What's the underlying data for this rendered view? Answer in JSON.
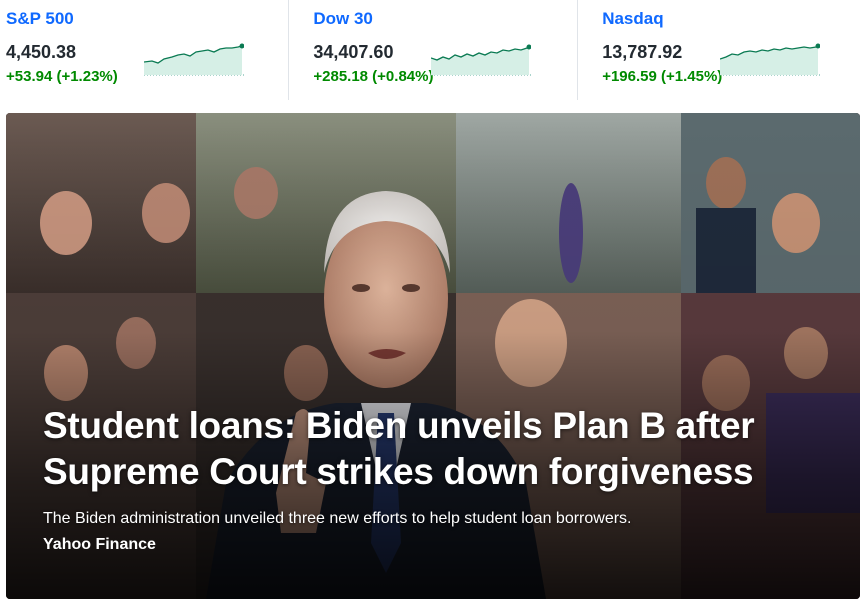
{
  "tickers": [
    {
      "name": "S&P 500",
      "price": "4,450.38",
      "change": "+53.94 (+1.23%)"
    },
    {
      "name": "Dow 30",
      "price": "34,407.60",
      "change": "+285.18 (+0.84%)"
    },
    {
      "name": "Nasdaq",
      "price": "13,787.92",
      "change": "+196.59 (+1.45%)"
    }
  ],
  "colors": {
    "link": "#0f69ff",
    "positive": "#008a00",
    "spark_fill": "#d6efe6",
    "spark_line": "#0a7a52"
  },
  "hero": {
    "title": "Student loans: Biden unveils Plan B after Supreme Court strikes down forgiveness",
    "description": "The Biden administration unveiled three new efforts to help student loan borrowers.",
    "source": "Yahoo Finance"
  }
}
